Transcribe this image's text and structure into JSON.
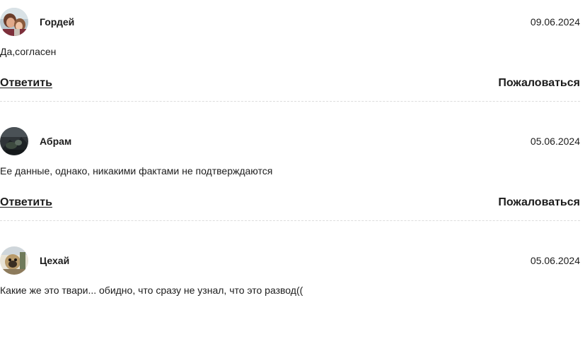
{
  "comments": [
    {
      "author": "Гордей",
      "date": "09.06.2024",
      "text": "Да,согласен",
      "reply_label": "Ответить",
      "report_label": "Пожаловаться",
      "avatar_icon": "user-avatar-photo"
    },
    {
      "author": "Абрам",
      "date": "05.06.2024",
      "text": "Ее данные, однако, никакими фактами не подтверждаются",
      "reply_label": "Ответить",
      "report_label": "Пожаловаться",
      "avatar_icon": "user-avatar-photo"
    },
    {
      "author": "Цехай",
      "date": "05.06.2024",
      "text": "Какие же это твари... обидно, что сразу не узнал, что это развод((",
      "avatar_icon": "user-avatar-photo"
    }
  ]
}
